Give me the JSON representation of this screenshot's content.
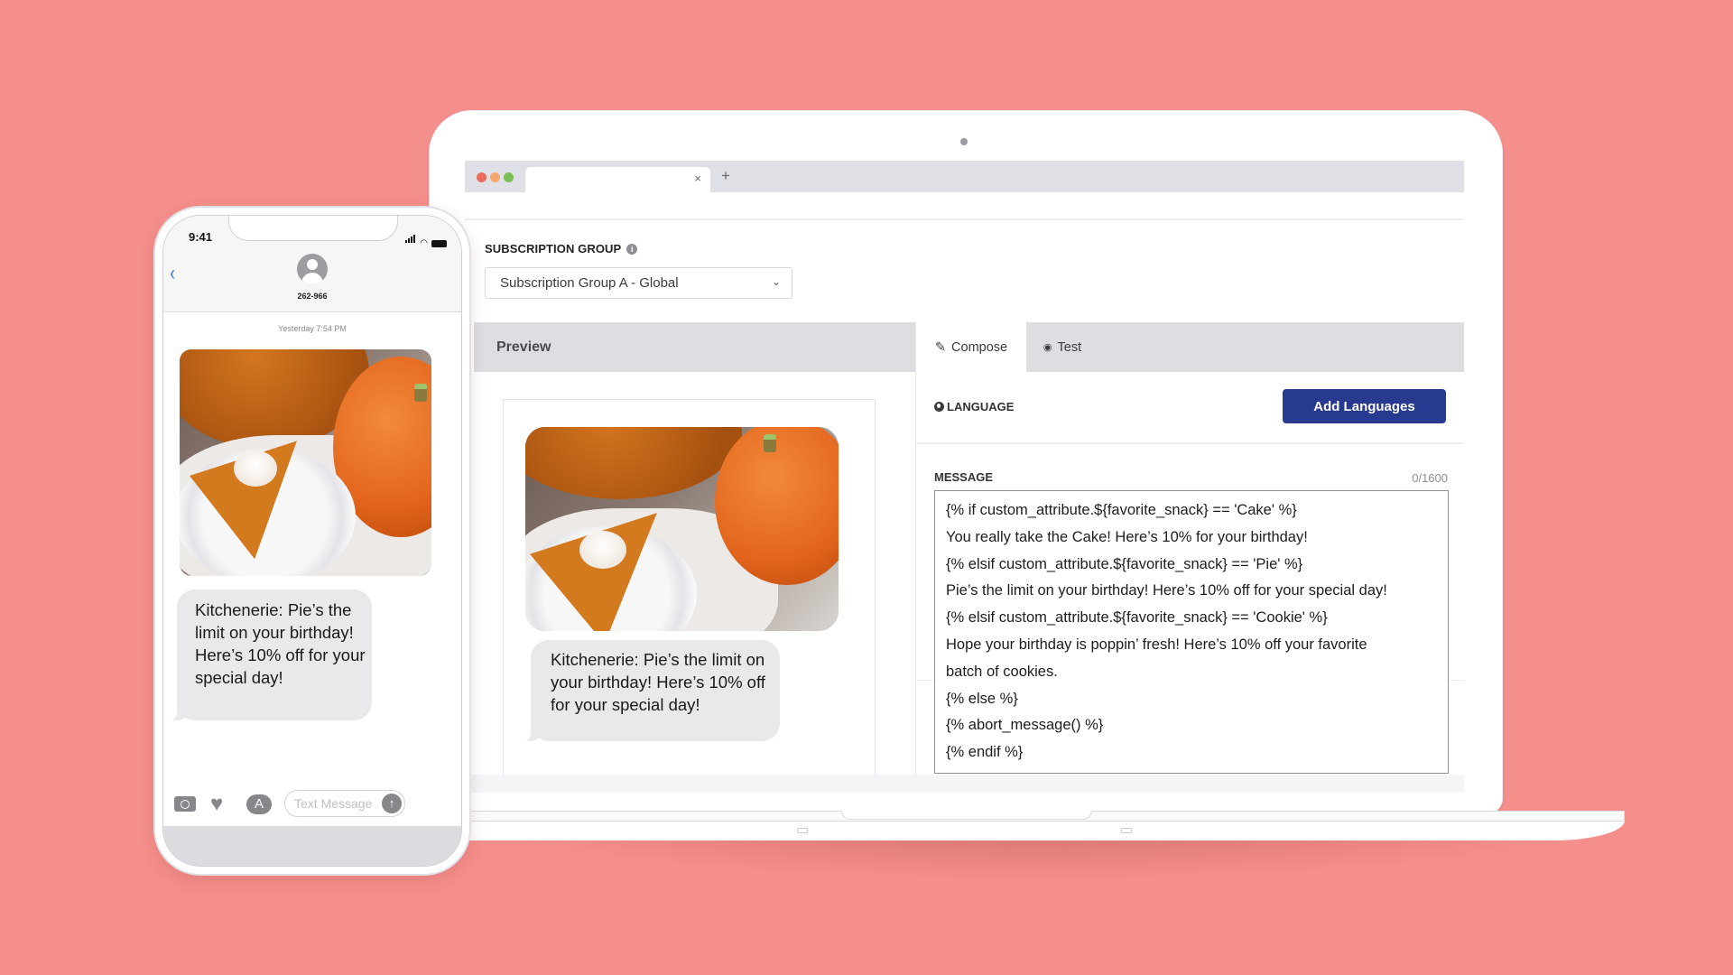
{
  "background_color": "#f58f8c",
  "laptop": {
    "browser": {
      "traffic_lights": [
        "#ec6a5e",
        "#f4a86e",
        "#7cbf56"
      ],
      "tab_close": "×",
      "new_tab": "+"
    },
    "subscription_group": {
      "label": "SUBSCRIPTION GROUP",
      "info_icon": "i",
      "selected": "Subscription Group A - Global",
      "chevron": "⌄"
    },
    "preview": {
      "title": "Preview",
      "bubble_text": "Kitchenerie: Pie’s the limit on your birthday! Here’s 10% off for your special day!"
    },
    "tabs": [
      {
        "label": "Compose",
        "icon": "pencil-icon",
        "glyph": "✎",
        "active": true
      },
      {
        "label": "Test",
        "icon": "eye-icon",
        "glyph": "👁",
        "active": false
      }
    ],
    "language": {
      "label": "LANGUAGE",
      "button": "Add Languages",
      "button_color": "#283a8f"
    },
    "message": {
      "label": "MESSAGE",
      "count": "0/1600",
      "lines": [
        "{% if custom_attribute.${favorite_snack} == 'Cake' %}",
        "You really take the Cake! Here’s 10% for your birthday!",
        "{% elsif custom_attribute.${favorite_snack} == 'Pie' %}",
        "Pie’s the limit on your birthday! Here’s 10% off for your special day!",
        "{% elsif custom_attribute.${favorite_snack} == 'Cookie' %}",
        "Hope your birthday is poppin’ fresh! Here’s 10% off your favorite",
        "batch of cookies.",
        "{% else %}",
        "{% abort_message() %}",
        "{% endif %}"
      ]
    }
  },
  "phone": {
    "time": "9:41",
    "back": "‹",
    "contact": "262-966",
    "timestamp": "Yesterday 7:54 PM",
    "bubble_text": "Kitchenerie: Pie’s the limit on your birthday! Here’s 10% off for your special day!",
    "input_placeholder": "Text Message",
    "send": "↑",
    "appstore": "A",
    "heart": "♥"
  }
}
